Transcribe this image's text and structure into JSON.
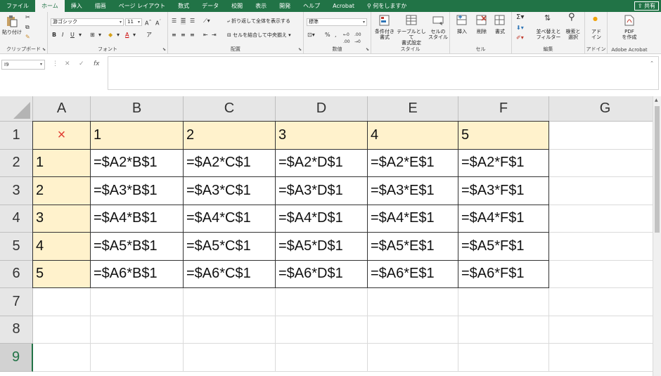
{
  "menu": {
    "tabs": [
      "ファイル",
      "ホーム",
      "挿入",
      "描画",
      "ページ レイアウト",
      "数式",
      "データ",
      "校閲",
      "表示",
      "開発",
      "ヘルプ",
      "Acrobat",
      "何をしますか"
    ],
    "active_index": 1,
    "share_label": "共有"
  },
  "ribbon": {
    "clipboard": {
      "label": "クリップボード",
      "paste_label": "貼り付け"
    },
    "font": {
      "label": "フォント",
      "font_name": "游ゴシック",
      "font_size": "11"
    },
    "alignment": {
      "label": "配置",
      "wrap_label": "折り返して全体を表示する",
      "merge_label": "セルを結合して中央揃え"
    },
    "number": {
      "label": "数値",
      "format": "標準"
    },
    "styles": {
      "label": "スタイル",
      "cond_label": "条件付き\n書式",
      "table_label": "テーブルとして\n書式設定",
      "cell_label": "セルの\nスタイル"
    },
    "cells": {
      "label": "セル",
      "insert_label": "挿入",
      "delete_label": "削除",
      "format_label": "書式"
    },
    "editing": {
      "label": "編集",
      "sort_label": "並べ替えと\nフィルター",
      "find_label": "検索と\n選択"
    },
    "addins": {
      "label": "アドイン",
      "addin_label": "アド\nイン"
    },
    "acrobat": {
      "label": "Adobe Acrobat",
      "pdf_label": "PDF\nを作成"
    }
  },
  "formula_bar": {
    "name_box": "I9",
    "formula": ""
  },
  "grid": {
    "columns": [
      "A",
      "B",
      "C",
      "D",
      "E",
      "F",
      "G"
    ],
    "rows": [
      "1",
      "2",
      "3",
      "4",
      "5",
      "6",
      "7",
      "8",
      "9"
    ],
    "selected_row": "9",
    "cells": [
      [
        "×",
        "1",
        "2",
        "3",
        "4",
        "5",
        ""
      ],
      [
        "1",
        "=$A2*B$1",
        "=$A2*C$1",
        "=$A2*D$1",
        "=$A2*E$1",
        "=$A2*F$1",
        ""
      ],
      [
        "2",
        "=$A3*B$1",
        "=$A3*C$1",
        "=$A3*D$1",
        "=$A3*E$1",
        "=$A3*F$1",
        ""
      ],
      [
        "3",
        "=$A4*B$1",
        "=$A4*C$1",
        "=$A4*D$1",
        "=$A4*E$1",
        "=$A4*F$1",
        ""
      ],
      [
        "4",
        "=$A5*B$1",
        "=$A5*C$1",
        "=$A5*D$1",
        "=$A5*E$1",
        "=$A5*F$1",
        ""
      ],
      [
        "5",
        "=$A6*B$1",
        "=$A6*C$1",
        "=$A6*D$1",
        "=$A6*E$1",
        "=$A6*F$1",
        ""
      ],
      [
        "",
        "",
        "",
        "",
        "",
        "",
        ""
      ],
      [
        "",
        "",
        "",
        "",
        "",
        "",
        ""
      ],
      [
        "",
        "",
        "",
        "",
        "",
        "",
        ""
      ]
    ]
  },
  "colors": {
    "accent": "#217346",
    "header_fill": "#fff2cc",
    "mark": "#e03c31"
  }
}
